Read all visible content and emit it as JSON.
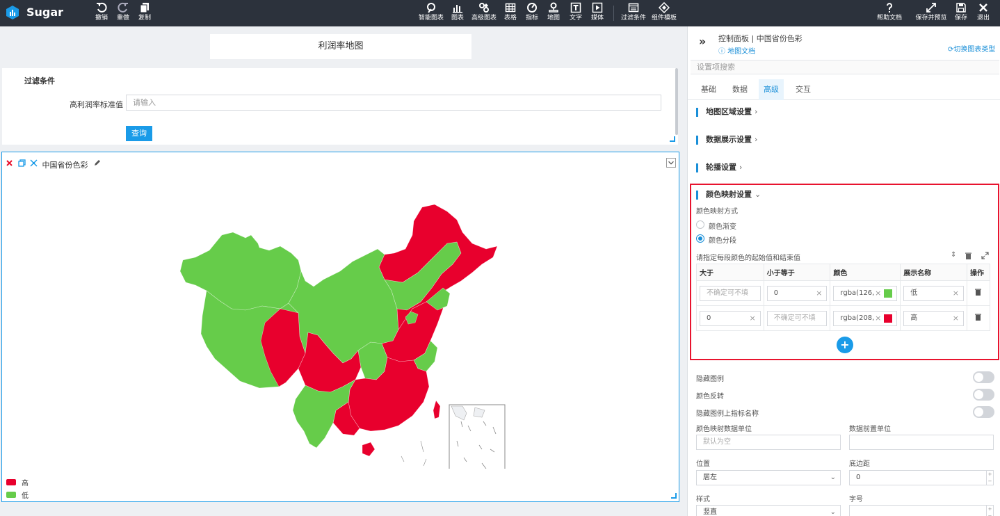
{
  "app": {
    "brand": "Sugar"
  },
  "toolbar": {
    "undo": "撤销",
    "redo": "重做",
    "copy": "复制",
    "smart_chart": "智能图表",
    "chart": "图表",
    "adv_chart": "高级图表",
    "table": "表格",
    "indicator": "指标",
    "map": "地图",
    "text": "文字",
    "media": "媒体",
    "filter": "过滤条件",
    "component_template": "组件模板",
    "help": "帮助文档",
    "save_preview": "保存并预览",
    "save": "保存",
    "exit": "退出"
  },
  "canvas": {
    "title": "利润率地图",
    "filter": {
      "title": "过滤条件",
      "label": "高利润率标准值",
      "placeholder": "请输入",
      "query": "查询"
    },
    "map": {
      "name": "中国省份色彩",
      "legend": [
        {
          "label": "高",
          "color": "#e8002d"
        },
        {
          "label": "低",
          "color": "#66cc4a"
        }
      ]
    }
  },
  "panel": {
    "header_title": "控制面板 | 中国省份色彩",
    "doc_link": "地图文档",
    "switch_type": "切换图表类型",
    "search_placeholder": "设置项搜索",
    "tabs": [
      "基础",
      "数据",
      "高级",
      "交互"
    ],
    "active_tab": "高级",
    "sections": {
      "map_area": "地图区域设置",
      "data_display": "数据展示设置",
      "carousel": "轮播设置",
      "color_mapping": "颜色映射设置"
    },
    "color_mode_label": "颜色映射方式",
    "modes": [
      "颜色渐变",
      "颜色分段"
    ],
    "selected_mode": "颜色分段",
    "segment_hint": "请指定每段颜色的起始值和结束值",
    "table": {
      "headers": [
        "大于",
        "小于等于",
        "颜色",
        "展示名称",
        "操作"
      ],
      "rows": [
        {
          "gt": "",
          "gt_placeholder": "不确定可不填",
          "lte": "0",
          "lte_placeholder": "",
          "color_text": "rgba(126,",
          "color": "#66cc4a",
          "name": "低"
        },
        {
          "gt": "0",
          "gt_placeholder": "",
          "lte": "",
          "lte_placeholder": "不确定可不填",
          "color_text": "rgba(208,",
          "color": "#e8002d",
          "name": "高"
        }
      ]
    },
    "hide_legend": "隐藏图例",
    "color_reverse": "颜色反转",
    "hide_legend_metric": "隐藏图例上指标名称",
    "unit_label": "颜色映射数据单位",
    "unit_placeholder": "默认为空",
    "prefix_label": "数据前置单位",
    "position_label": "位置",
    "position_value": "居左",
    "bottom_label": "底边距",
    "bottom_value": "0",
    "style_label": "样式",
    "style_value": "竖直",
    "fontsize_label": "字号"
  }
}
